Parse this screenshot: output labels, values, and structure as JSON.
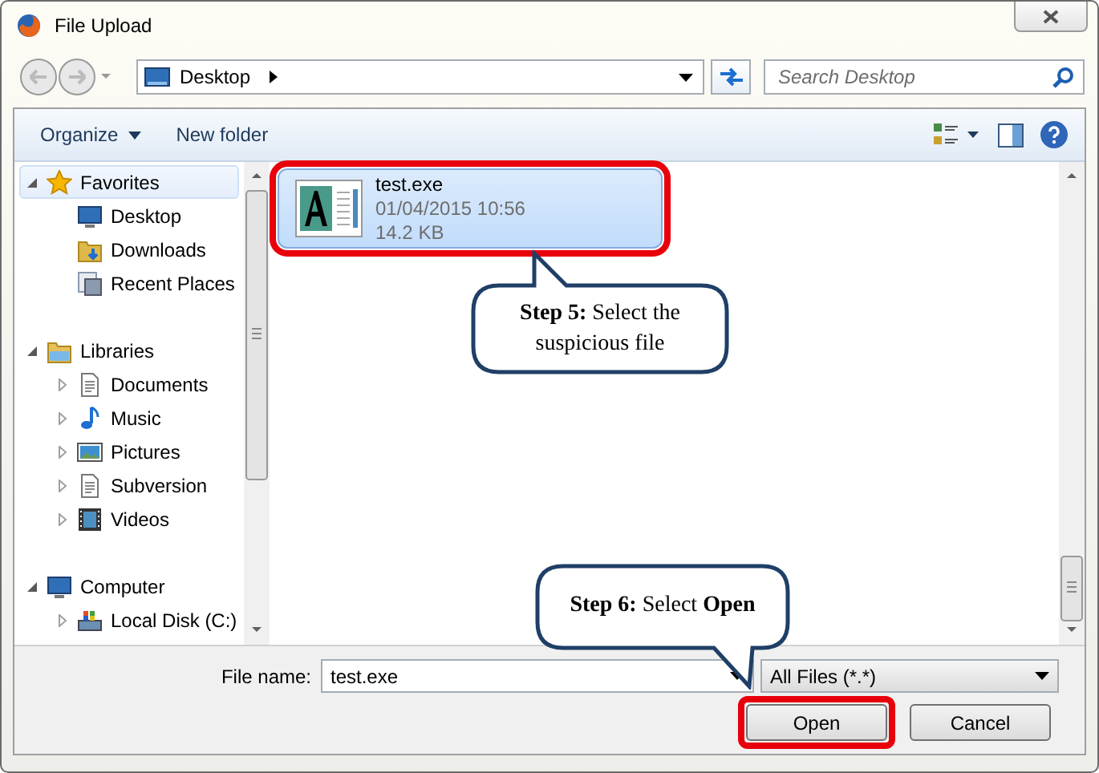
{
  "window": {
    "title": "File Upload"
  },
  "address": {
    "location": "Desktop"
  },
  "search": {
    "placeholder": "Search Desktop"
  },
  "toolbar": {
    "items": [
      {
        "label": "Organize",
        "kind": "menu"
      },
      {
        "label": "New folder",
        "kind": "button"
      }
    ]
  },
  "nav": [
    {
      "label": "Favorites",
      "kind": "favorites",
      "expanded": true,
      "selected": true,
      "children": [
        {
          "label": "Desktop",
          "kind": "desktop",
          "selected": false
        },
        {
          "label": "Downloads",
          "kind": "downloads",
          "selected": false
        },
        {
          "label": "Recent Places",
          "kind": "recent",
          "selected": false
        }
      ]
    },
    {
      "label": "Libraries",
      "kind": "libraries",
      "expanded": true,
      "selected": false,
      "children": [
        {
          "label": "Documents",
          "kind": "documents",
          "expanded": false,
          "selected": false
        },
        {
          "label": "Music",
          "kind": "music",
          "expanded": false,
          "selected": false
        },
        {
          "label": "Pictures",
          "kind": "pictures",
          "expanded": false,
          "selected": false
        },
        {
          "label": "Subversion",
          "kind": "documents",
          "expanded": false,
          "selected": false
        },
        {
          "label": "Videos",
          "kind": "videos",
          "expanded": false,
          "selected": false
        }
      ]
    },
    {
      "label": "Computer",
      "kind": "computer",
      "expanded": true,
      "selected": false,
      "children": [
        {
          "label": "Local Disk (C:)",
          "kind": "disk",
          "expanded": false,
          "selected": false
        }
      ]
    }
  ],
  "files": [
    {
      "name": "test.exe",
      "date": "01/04/2015 10:56",
      "size": "14.2 KB",
      "selected": true,
      "highlighted": true
    }
  ],
  "footer": {
    "file_name_label": "File name:",
    "file_name": "test.exe",
    "filter": "All Files (*.*)",
    "buttons": [
      {
        "label": "Open",
        "highlighted": true
      },
      {
        "label": "Cancel",
        "highlighted": false
      }
    ]
  },
  "callouts": [
    {
      "text": "**Step 5:** Select the suspicious file",
      "kind": "up"
    },
    {
      "text": "**Step 6:** Select **Open**",
      "kind": "down"
    }
  ]
}
